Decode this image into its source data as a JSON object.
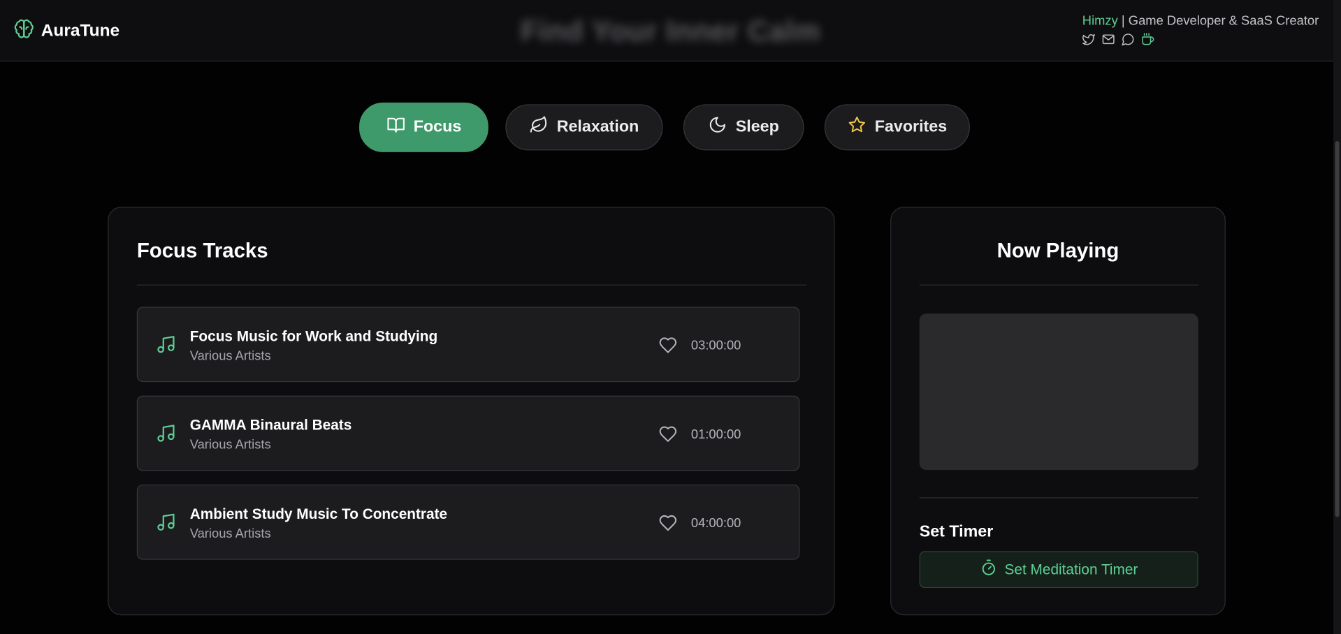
{
  "header": {
    "app_name": "AuraTune",
    "hero_title": "Find Your Inner Calm",
    "creator_name": "Himzy",
    "creator_separator": "|",
    "creator_role": "Game Developer & SaaS Creator",
    "social_icons": [
      "twitter-icon",
      "mail-icon",
      "chat-icon",
      "coffee-icon"
    ]
  },
  "tabs": [
    {
      "label": "Focus",
      "icon": "book-icon",
      "active": true
    },
    {
      "label": "Relaxation",
      "icon": "leaf-icon",
      "active": false
    },
    {
      "label": "Sleep",
      "icon": "moon-icon",
      "active": false
    },
    {
      "label": "Favorites",
      "icon": "star-icon",
      "active": false
    }
  ],
  "tracks_panel": {
    "title": "Focus Tracks",
    "tracks": [
      {
        "title": "Focus Music for Work and Studying",
        "artist": "Various Artists",
        "duration": "03:00:00"
      },
      {
        "title": "GAMMA Binaural Beats",
        "artist": "Various Artists",
        "duration": "01:00:00"
      },
      {
        "title": "Ambient Study Music To Concentrate",
        "artist": "Various Artists",
        "duration": "04:00:00"
      }
    ]
  },
  "now_playing": {
    "title": "Now Playing",
    "timer_label": "Set Timer",
    "timer_button_label": "Set Meditation Timer"
  },
  "colors": {
    "accent": "#3f9a6b",
    "accent_text": "#5fcf94",
    "background": "#020202",
    "panel": "#0d0d0f",
    "star": "#f0c447"
  }
}
